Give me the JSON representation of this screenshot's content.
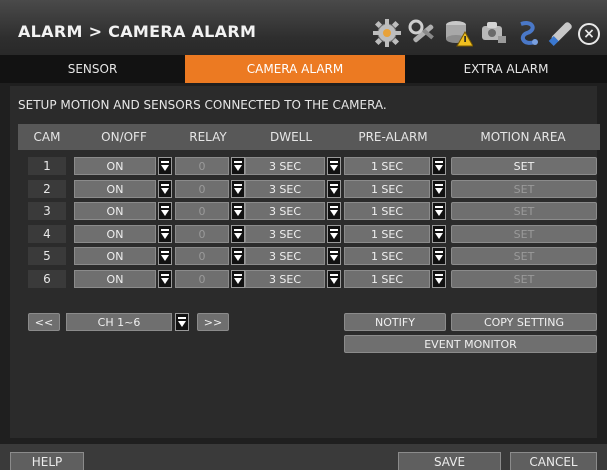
{
  "header": {
    "title": "ALARM > CAMERA ALARM"
  },
  "tabs": [
    {
      "label": "SENSOR"
    },
    {
      "label": "CAMERA ALARM"
    },
    {
      "label": "EXTRA ALARM"
    }
  ],
  "description": "SETUP MOTION AND SENSORS CONNECTED TO THE CAMERA.",
  "columns": [
    "CAM",
    "ON/OFF",
    "RELAY",
    "DWELL",
    "PRE-ALARM",
    "MOTION AREA"
  ],
  "rows": [
    {
      "cam": "1",
      "onoff": "ON",
      "relay": "0",
      "dwell": "3 SEC",
      "prealarm": "1 SEC",
      "area": "SET"
    },
    {
      "cam": "2",
      "onoff": "ON",
      "relay": "0",
      "dwell": "3 SEC",
      "prealarm": "1 SEC",
      "area": "SET"
    },
    {
      "cam": "3",
      "onoff": "ON",
      "relay": "0",
      "dwell": "3 SEC",
      "prealarm": "1 SEC",
      "area": "SET"
    },
    {
      "cam": "4",
      "onoff": "ON",
      "relay": "0",
      "dwell": "3 SEC",
      "prealarm": "1 SEC",
      "area": "SET"
    },
    {
      "cam": "5",
      "onoff": "ON",
      "relay": "0",
      "dwell": "3 SEC",
      "prealarm": "1 SEC",
      "area": "SET"
    },
    {
      "cam": "6",
      "onoff": "ON",
      "relay": "0",
      "dwell": "3 SEC",
      "prealarm": "1 SEC",
      "area": "SET"
    }
  ],
  "pager": {
    "prev": "<<",
    "channel": "CH 1~6",
    "next": ">>"
  },
  "actions": {
    "notify": "NOTIFY",
    "copy": "COPY SETTING",
    "event_monitor": "EVENT MONITOR"
  },
  "footer": {
    "help": "HELP",
    "save": "SAVE",
    "cancel": "CANCEL"
  },
  "icons": [
    "gear-icon",
    "tools-icon",
    "storage-alert-icon",
    "network-icon",
    "info-icon",
    "remote-icon",
    "close-icon"
  ],
  "colors": {
    "accent": "#ec7a22"
  }
}
